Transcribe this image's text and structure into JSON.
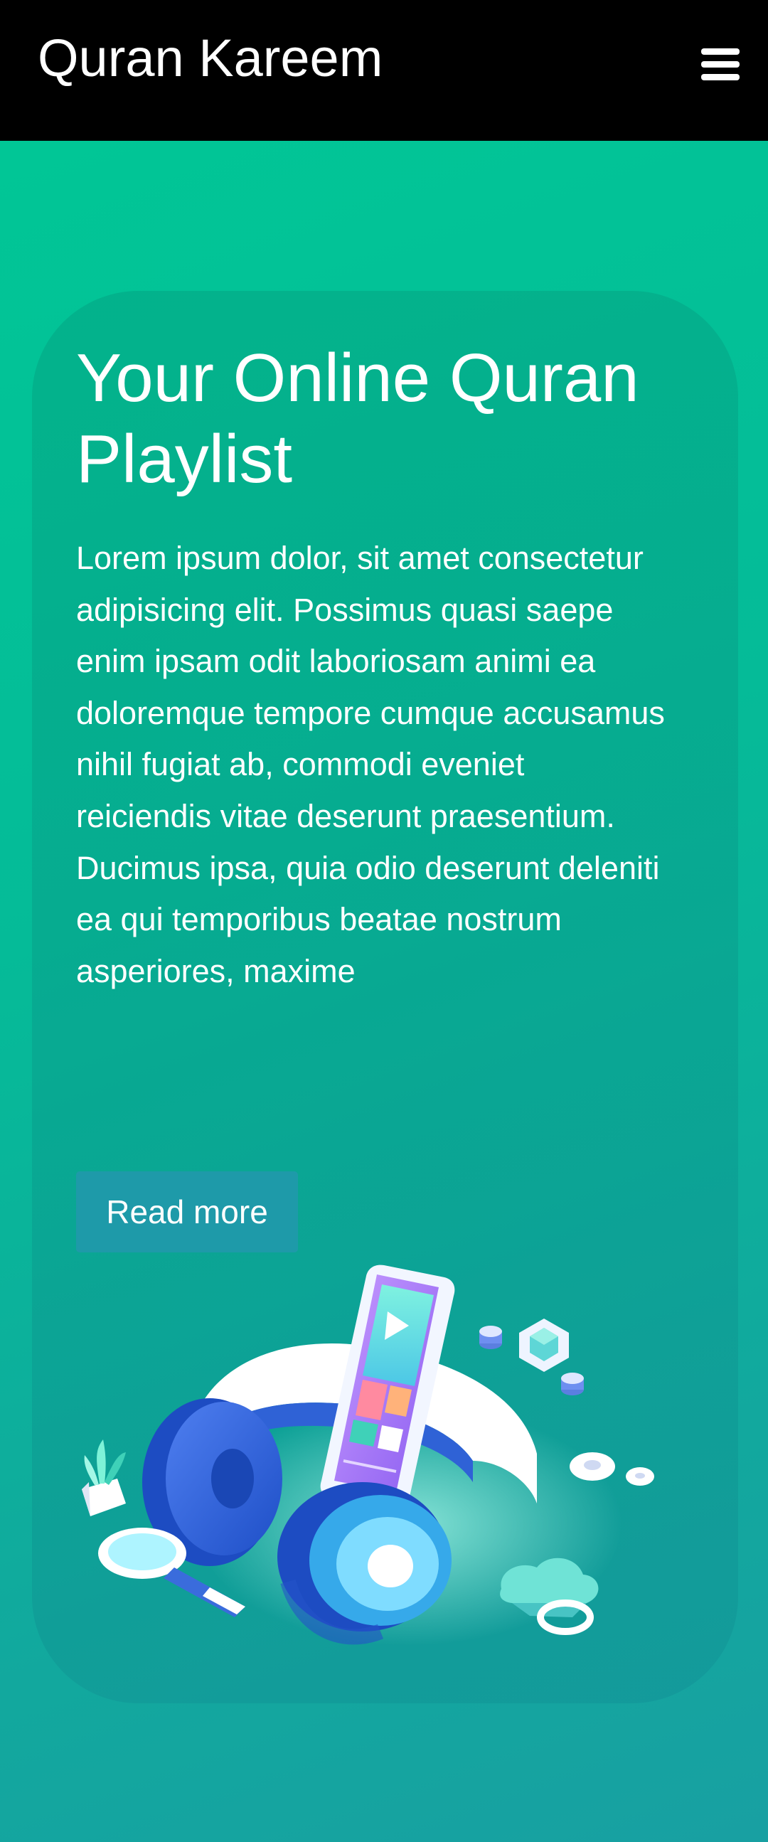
{
  "header": {
    "brand": "Quran Kareem",
    "menu_icon": "hamburger-menu-icon"
  },
  "hero": {
    "title": "Your Online Quran Playlist",
    "description": "Lorem ipsum dolor, sit amet consectetur adipisicing elit. Possimus quasi saepe enim ipsam odit laboriosam animi ea doloremque tempore cumque accusamus nihil fugiat ab, commodi eveniet reiciendis vitae deserunt praesentium. Ducimus ipsa, quia odio deserunt deleniti ea qui temporibus beatae nostrum asperiores, maxime",
    "button_label": "Read more",
    "illustration": "headphones-phone-illustration"
  },
  "colors": {
    "header_bg": "#000000",
    "page_bg_start": "#00c896",
    "page_bg_end": "#18a0a2",
    "button_bg": "#1e9aa9",
    "text": "#ffffff"
  }
}
